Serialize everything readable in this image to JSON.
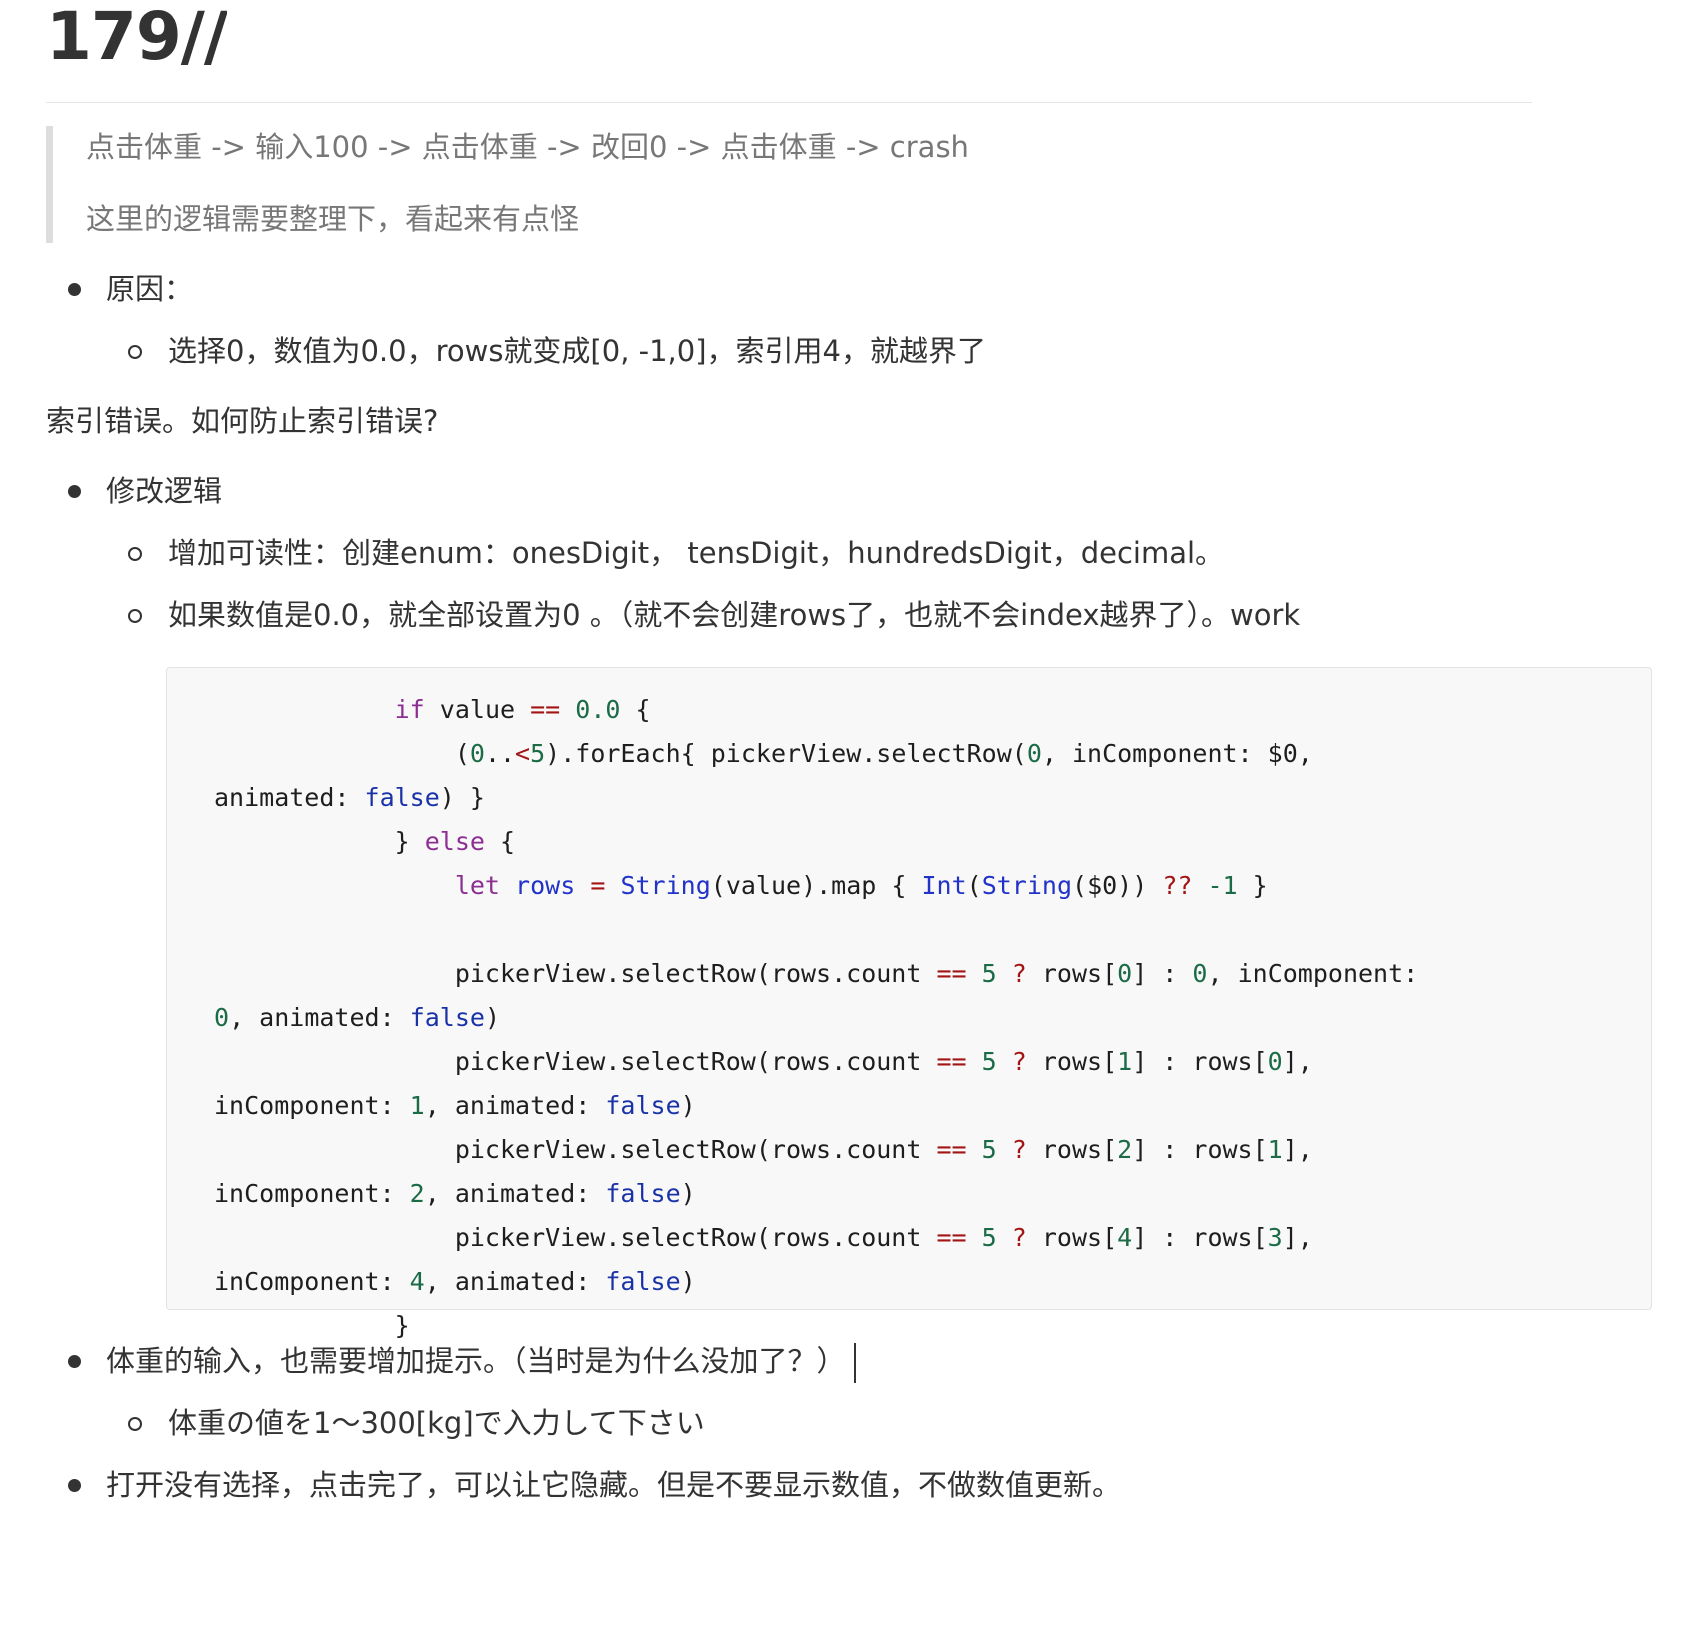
{
  "title": "179//",
  "quote": {
    "line1": "点击体重 -> 输入100 -> 点击体重 -> 改回0 -> 点击体重 -> crash",
    "line2": "这里的逻辑需要整理下，看起来有点怪"
  },
  "cause": {
    "label": "原因：",
    "detail": "选择0，数值为0.0，rows就变成[0, -1,0]，索引用4，就越界了"
  },
  "index_error_text": "索引错误。如何防止索引错误?",
  "fix": {
    "label": "修改逻辑",
    "sub1": "增加可读性：创建enum：onesDigit， tensDigit，hundredsDigit，decimal。",
    "sub2": "如果数值是0.0，就全部设置为0 。（就不会创建rows了，也就不会index越界了）。work"
  },
  "weight_hint": {
    "label": "体重的输入，也需要增加提示。（当时是为什么没加了？）",
    "sub": "体重の値を1～300[kg]で入力して下さい"
  },
  "hide_note": "打开没有选择，点击完了，可以让它隐藏。但是不要显示数值，不做数值更新。",
  "code": {
    "language": "swift"
  }
}
